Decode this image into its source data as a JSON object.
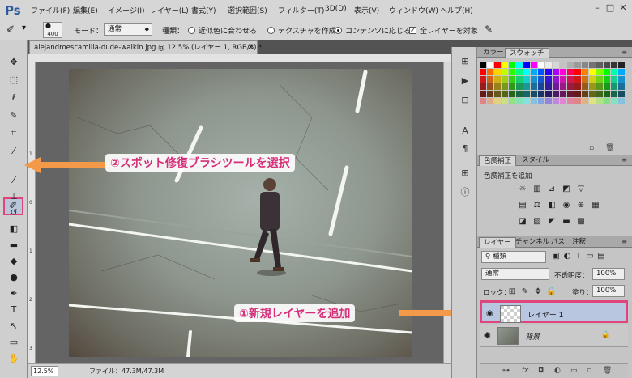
{
  "app": {
    "logo": "Ps"
  },
  "menu": [
    "ファイル(F)",
    "編集(E)",
    "イメージ(I)",
    "レイヤー(L)",
    "書式(Y)",
    "選択範囲(S)",
    "フィルター(T)",
    "3D(D)",
    "表示(V)",
    "ウィンドウ(W)",
    "ヘルプ(H)"
  ],
  "options_bar": {
    "brush_size": "400",
    "mode_label": "モード：",
    "mode_value": "通常",
    "type_label": "種類：",
    "radio_1": "近似色に合わせる",
    "radio_2": "テクスチャを作成",
    "radio_3": "コンテンツに応じる",
    "selected_radio": 3,
    "all_layers_label": "全レイヤーを対象",
    "all_layers_checked": true
  },
  "document": {
    "tab_title": "alejandroescamilla-dude-walkin.jpg @ 12.5% (レイヤー 1, RGB/8) *",
    "zoom": "12.5%",
    "file_info": "ファイル：47.3M/47.3M",
    "ruler_left": [
      "1",
      "0",
      "1",
      "2",
      "3"
    ]
  },
  "panels": {
    "color_tabs": [
      "カラー",
      "スウォッチ"
    ],
    "color_active": 1,
    "adjust_tabs": [
      "色調補正",
      "スタイル"
    ],
    "adjust_active": 0,
    "adjust_title": "色調補正を追加",
    "layers_tabs": [
      "レイヤー",
      "チャンネル",
      "パス",
      "注釈"
    ],
    "layers_active": 0,
    "filter_kind": "種類",
    "blend_mode": "通常",
    "opacity_label": "不透明度：",
    "opacity_value": "100%",
    "lock_label": "ロック：",
    "fill_label": "塗り：",
    "fill_value": "100%",
    "layers": [
      {
        "name": "レイヤー 1",
        "selected": true
      },
      {
        "name": "背景",
        "selected": false,
        "locked": true
      }
    ]
  },
  "annotations": {
    "step2": "②スポット修復ブラシツールを選択",
    "step1": "①新規レイヤーを追加"
  },
  "colors": {
    "accent_pink": "#e0447c",
    "annotation_text": "#d62f7a",
    "arrow_orange": "#f29a4a",
    "layer_selected": "#b8c6e0"
  }
}
